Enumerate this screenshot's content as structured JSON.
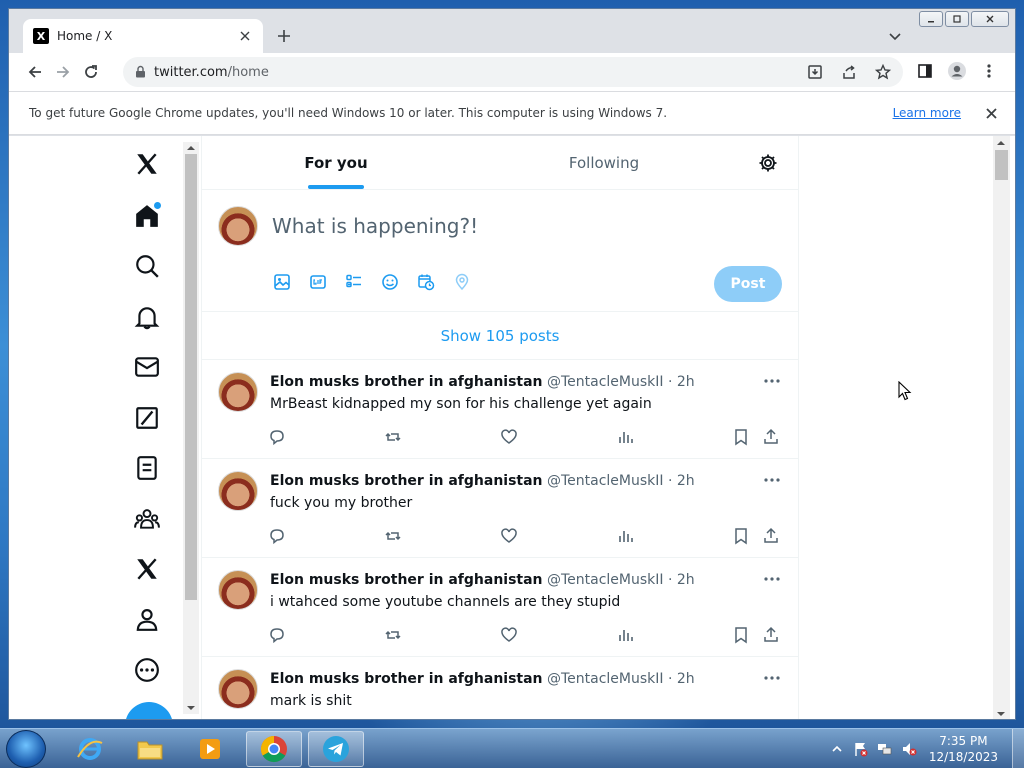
{
  "browser": {
    "tab_title": "Home / X",
    "tab_favicon": "X",
    "url_host": "twitter.com",
    "url_path": "/home"
  },
  "infobar": {
    "message": "To get future Google Chrome updates, you'll need Windows 10 or later. This computer is using Windows 7.",
    "link": "Learn more"
  },
  "nav_icons": [
    "x-logo-icon",
    "home-icon",
    "search-icon",
    "notifications-bell-icon",
    "messages-envelope-icon",
    "grok-slash-icon",
    "lists-icon",
    "communities-icon",
    "premium-x-icon",
    "profile-icon",
    "more-circle-icon"
  ],
  "timeline": {
    "tabs": [
      "For you",
      "Following"
    ],
    "active_tab": "For you"
  },
  "composer": {
    "placeholder": "What is happening?!",
    "post_label": "Post"
  },
  "show_posts": "Show 105 posts",
  "tweets": [
    {
      "name": "Elon musks brother in afghanistan",
      "handle": "@TentacleMuskII",
      "time": "· 2h",
      "text": "MrBeast kidnapped my son for his challenge yet again"
    },
    {
      "name": "Elon musks brother in afghanistan",
      "handle": "@TentacleMuskII",
      "time": "· 2h",
      "text": "fuck you my brother"
    },
    {
      "name": "Elon musks brother in afghanistan",
      "handle": "@TentacleMuskII",
      "time": "· 2h",
      "text": "i wtahced some youtube channels are they stupid"
    },
    {
      "name": "Elon musks brother in afghanistan",
      "handle": "@TentacleMuskII",
      "time": "· 2h",
      "text": "mark is shit"
    }
  ],
  "taskbar": {
    "time": "7:35 PM",
    "date": "12/18/2023"
  },
  "colors": {
    "accent": "#1d9bf0",
    "post_disabled": "#8ecdf8"
  }
}
